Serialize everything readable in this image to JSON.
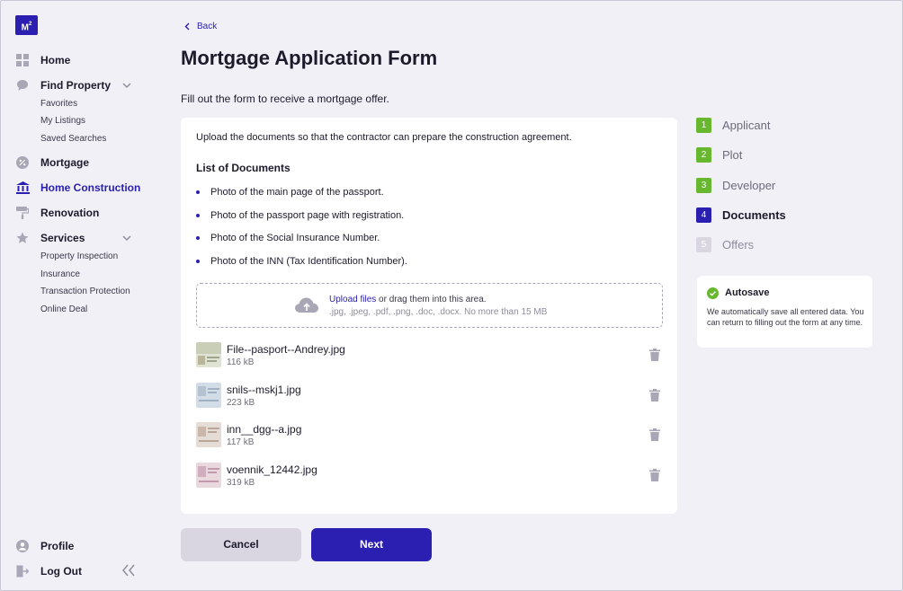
{
  "sidebar": {
    "logo": {
      "text": "M",
      "sup": "2"
    },
    "items": [
      {
        "label": "Home",
        "icon": "grid-icon"
      },
      {
        "label": "Find Property",
        "icon": "chat-bubble-icon",
        "sub": [
          "Favorites",
          "My Listings",
          "Saved Searches"
        ]
      },
      {
        "label": "Mortgage",
        "icon": "percent-icon"
      },
      {
        "label": "Home Construction",
        "icon": "bank-icon",
        "active": true
      },
      {
        "label": "Renovation",
        "icon": "paint-roller-icon"
      },
      {
        "label": "Services",
        "icon": "star-icon",
        "sub": [
          "Property Inspection",
          "Insurance",
          "Transaction Protection",
          "Online Deal"
        ]
      }
    ],
    "profile": "Profile",
    "logout": "Log Out"
  },
  "header": {
    "back": "Back",
    "title": "Mortgage Application Form",
    "subtitle": "Fill out the form to receive a mortgage offer."
  },
  "documents": {
    "intro": "Upload the documents so that the contractor can prepare the construction agreement.",
    "list_title": "List of Documents",
    "items": [
      "Photo of the main page of the passport.",
      "Photo of the passport page with registration.",
      "Photo of the Social Insurance Number.",
      "Photo of the INN (Tax Identification Number)."
    ],
    "upload": {
      "link": "Upload files",
      "text": " or drag them into this area.",
      "hint": ".jpg, .jpeg, .pdf, .png, .doc, .docx. No more than 15 MB"
    },
    "files": [
      {
        "name": "File--pasport--Andrey.jpg",
        "size": "116 kB"
      },
      {
        "name": "snils--mskj1.jpg",
        "size": "223 kB"
      },
      {
        "name": "inn__dgg--a.jpg",
        "size": "117 kB"
      },
      {
        "name": "voennik_12442.jpg",
        "size": "319 kB"
      }
    ]
  },
  "actions": {
    "cancel": "Cancel",
    "next": "Next"
  },
  "steps": [
    {
      "num": "1",
      "label": "Applicant",
      "state": "done"
    },
    {
      "num": "2",
      "label": "Plot",
      "state": "done"
    },
    {
      "num": "3",
      "label": "Developer",
      "state": "done"
    },
    {
      "num": "4",
      "label": "Documents",
      "state": "current"
    },
    {
      "num": "5",
      "label": "Offers",
      "state": "todo"
    }
  ],
  "autosave": {
    "title": "Autosave",
    "text": "We automatically save all entered data. You can return to filling out the form at any time."
  },
  "colors": {
    "accent": "#2a1fb0",
    "success": "#67b82e",
    "background": "#f1f0f7"
  }
}
